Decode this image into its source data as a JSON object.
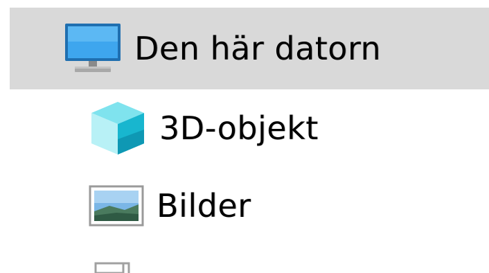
{
  "nav_tree": {
    "this_pc": {
      "label": "Den här datorn",
      "icon": "computer-icon",
      "selected": true
    },
    "items": [
      {
        "label": "3D-objekt",
        "icon": "3d-objects-icon"
      },
      {
        "label": "Bilder",
        "icon": "pictures-icon"
      }
    ],
    "partial_next_item": {
      "icon": "document-icon"
    }
  },
  "colors": {
    "selection_background": "#d9d9d9",
    "text": "#000000",
    "accent_blue": "#1e8fe0"
  }
}
